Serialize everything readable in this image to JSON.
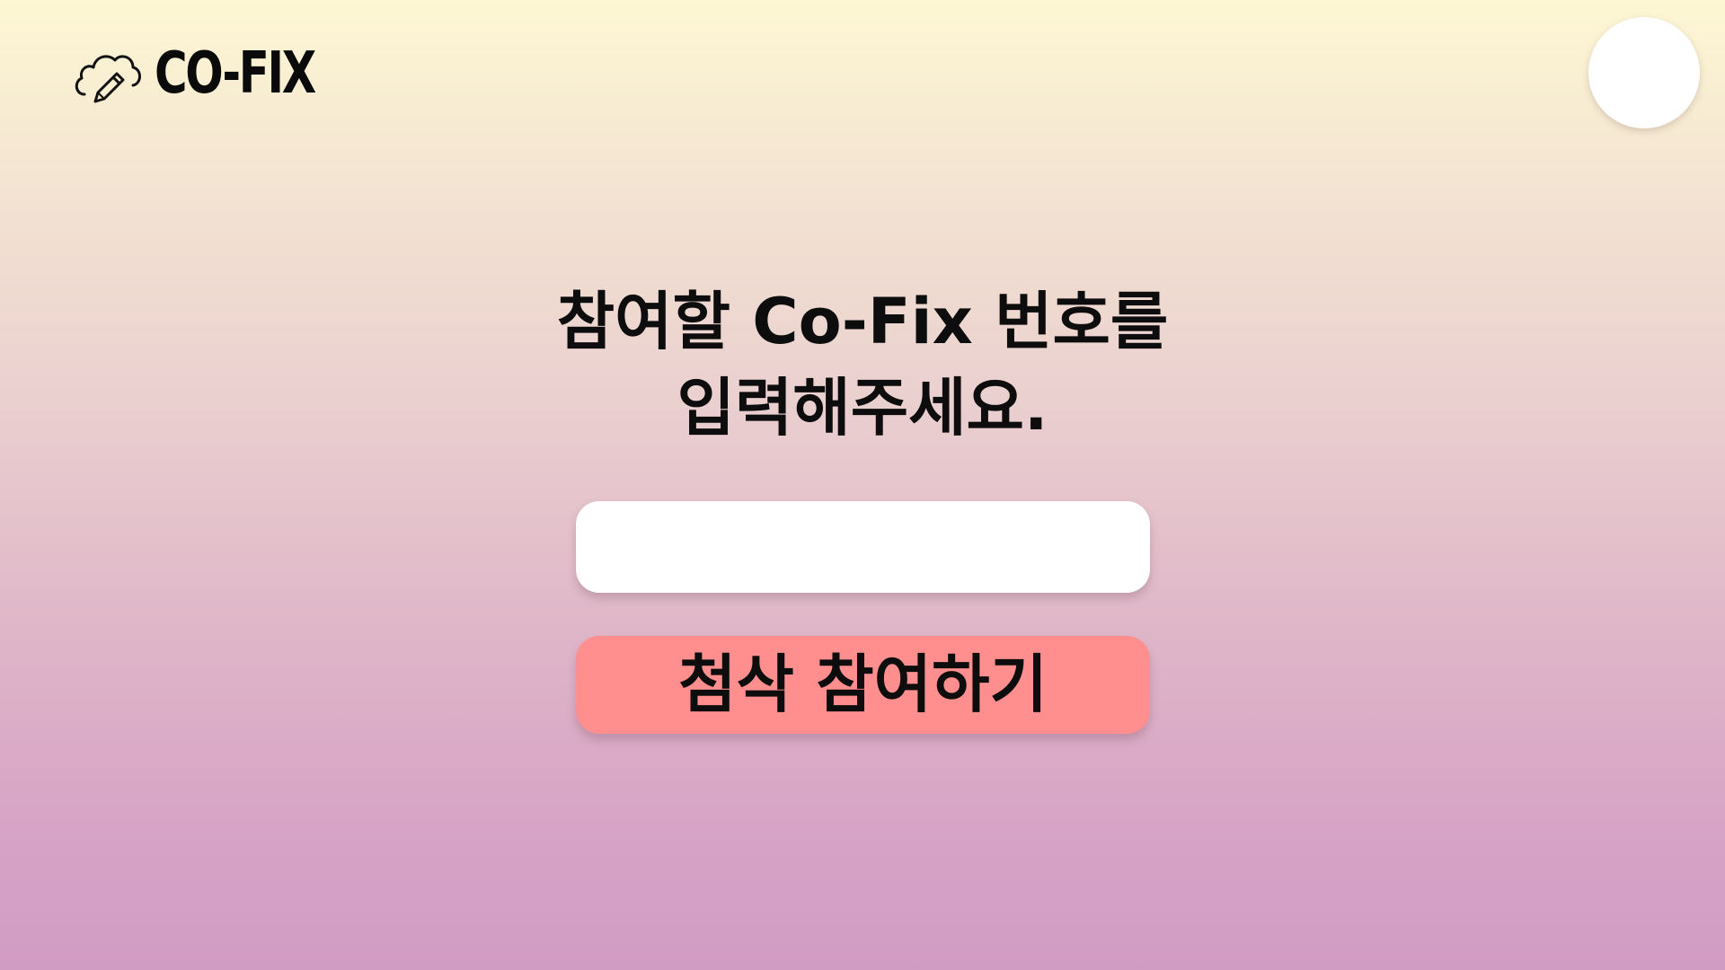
{
  "header": {
    "logo_text": "CO-FIX",
    "logo_icon": "cloud-pencil-icon",
    "avatar": "user-avatar"
  },
  "main": {
    "title_line1": "참여할 Co-Fix 번호를",
    "title_line2": "입력해주세요.",
    "code_input": {
      "value": "",
      "placeholder": ""
    },
    "join_button_label": "첨삭 참여하기"
  },
  "colors": {
    "background_top": "#fdf7d3",
    "background_bottom": "#d19cc4",
    "button": "#ff8e8e",
    "input": "#ffffff",
    "text": "#0d0d0d"
  }
}
